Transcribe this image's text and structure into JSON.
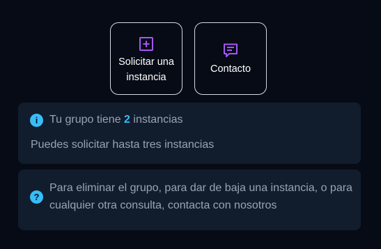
{
  "actions": {
    "request": {
      "label": "Solicitar una instancia",
      "icon": "plus-square-icon"
    },
    "contact": {
      "label": "Contacto",
      "icon": "message-icon"
    }
  },
  "info": {
    "prefix": "Tu grupo tiene",
    "count": "2",
    "suffix": "instancias",
    "note": "Puedes solicitar hasta tres instancias",
    "icon": "info-icon"
  },
  "help": {
    "text": "Para eliminar el grupo, para dar de baja una instancia, o para cualquier otra consulta, contacta con nosotros",
    "icon": "question-icon"
  },
  "colors": {
    "background": "#060b16",
    "card": "#111c2d",
    "accent_purple": "#a855f7",
    "accent_blue": "#38bdf8"
  }
}
